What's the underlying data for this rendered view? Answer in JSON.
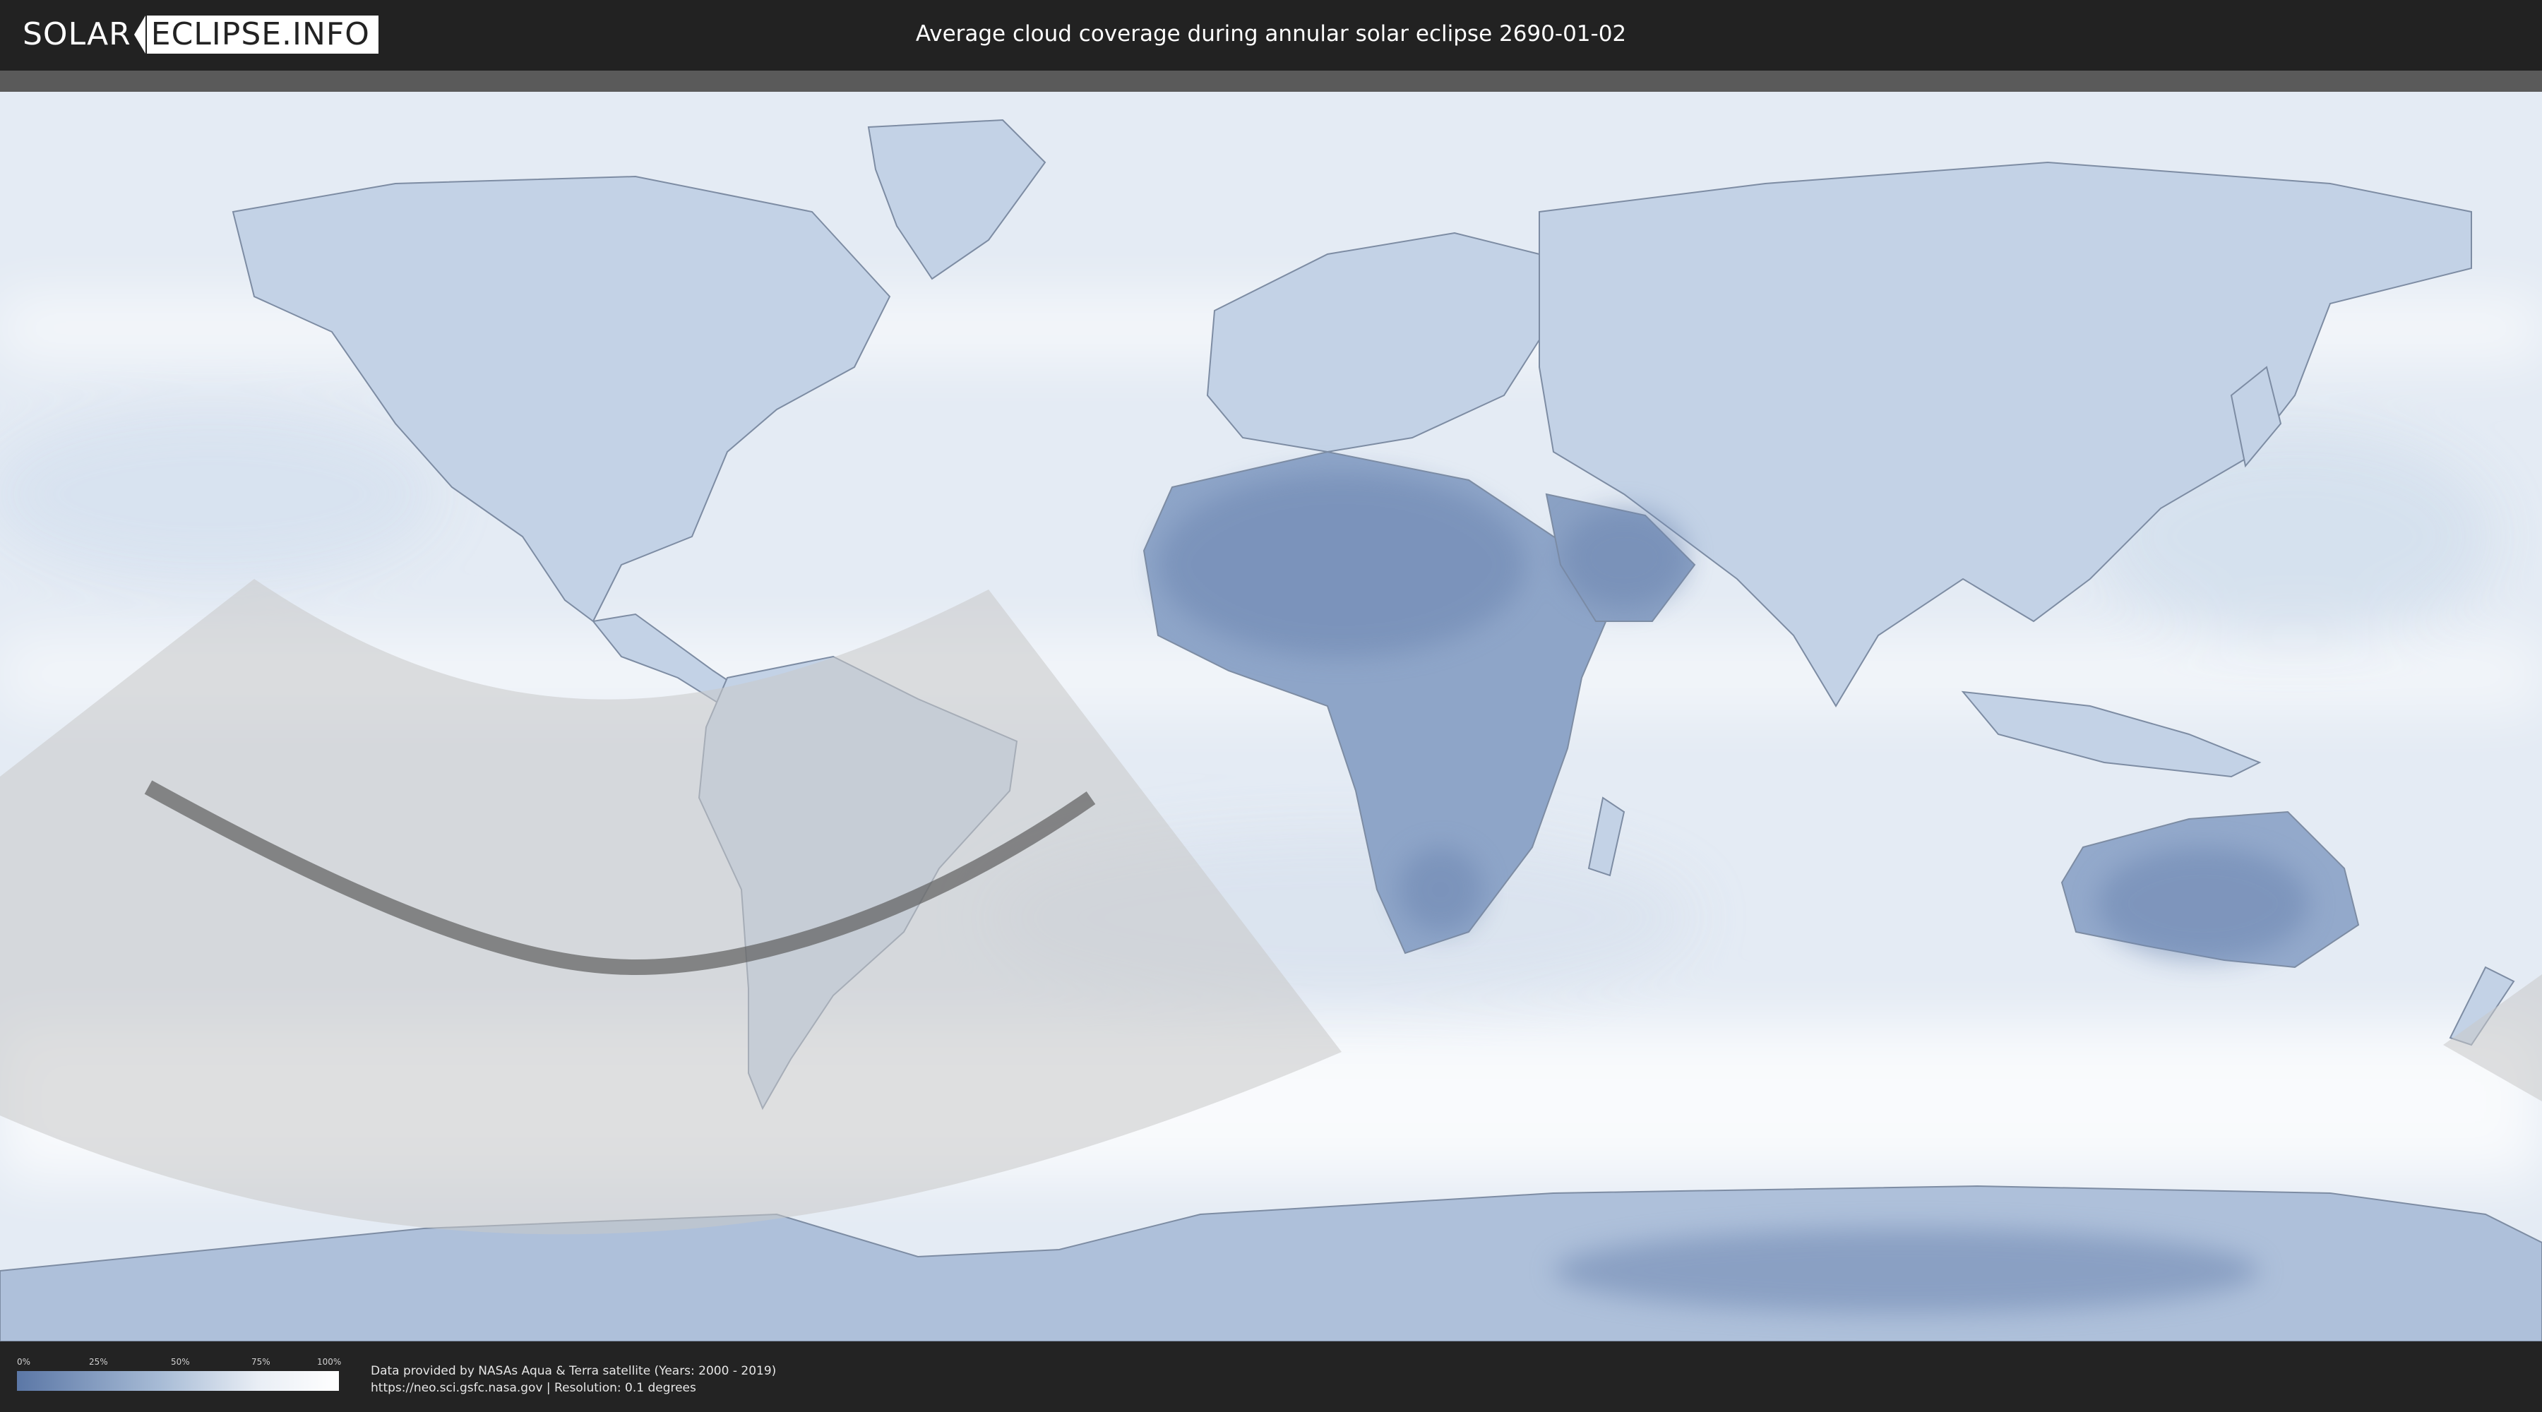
{
  "header": {
    "logo_left": "SOLAR",
    "logo_right": "ECLIPSE.INFO",
    "title": "Average cloud coverage during annular solar eclipse 2690-01-02"
  },
  "map": {
    "colors": {
      "ocean_cloudy": "#eef3f9",
      "clear_sky": "#5b77a6",
      "partial_zone": "#c8c8c8",
      "central_path": "#5e5e5e",
      "coastline": "#6f7f96"
    }
  },
  "legend": {
    "ticks": [
      "0%",
      "25%",
      "50%",
      "75%",
      "100%"
    ]
  },
  "credits": {
    "line1": "Data provided by NASAs Aqua & Terra satellite (Years: 2000 - 2019)",
    "line2": "https://neo.sci.gsfc.nasa.gov | Resolution: 0.1 degrees"
  }
}
